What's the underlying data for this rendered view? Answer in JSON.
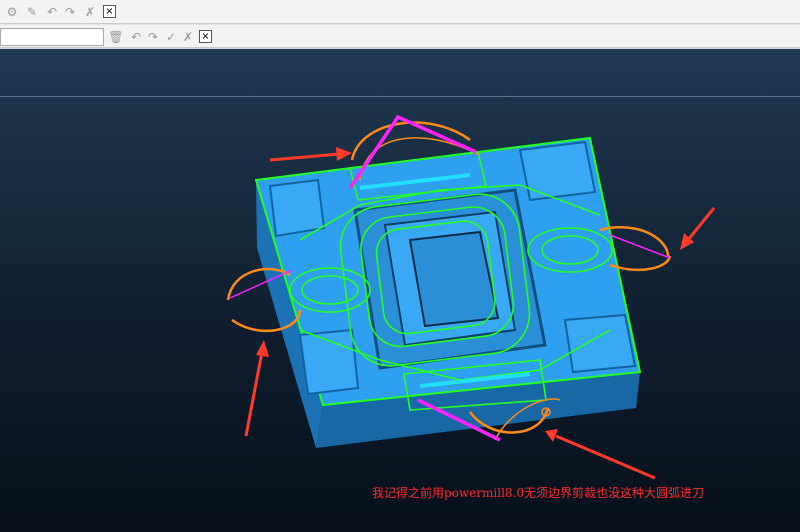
{
  "toolbar_row1": {
    "buttons": [
      "toolpath-settings-icon",
      "edit-icon",
      "undo-icon",
      "redo-icon",
      "cancel-icon"
    ],
    "close_label": "×"
  },
  "toolbar_row2": {
    "buttons": [
      "delete-icon",
      "undo-icon",
      "redo-icon",
      "accept-icon",
      "cancel-icon"
    ],
    "close_label": "×"
  },
  "colors": {
    "viewport_bg_top": "#203a52",
    "viewport_bg_bottom": "#07101b",
    "model": "#2f9ff0",
    "boundary": "#22ff22",
    "toolpath": "#22ff22",
    "lead_arc": "#ff8a18",
    "link": "#ff22ff",
    "annotation_arrow": "#ff3a2a"
  },
  "caption": "我记得之前用powermill8.0无须边界剪裁也没这种大圆弧进刀"
}
